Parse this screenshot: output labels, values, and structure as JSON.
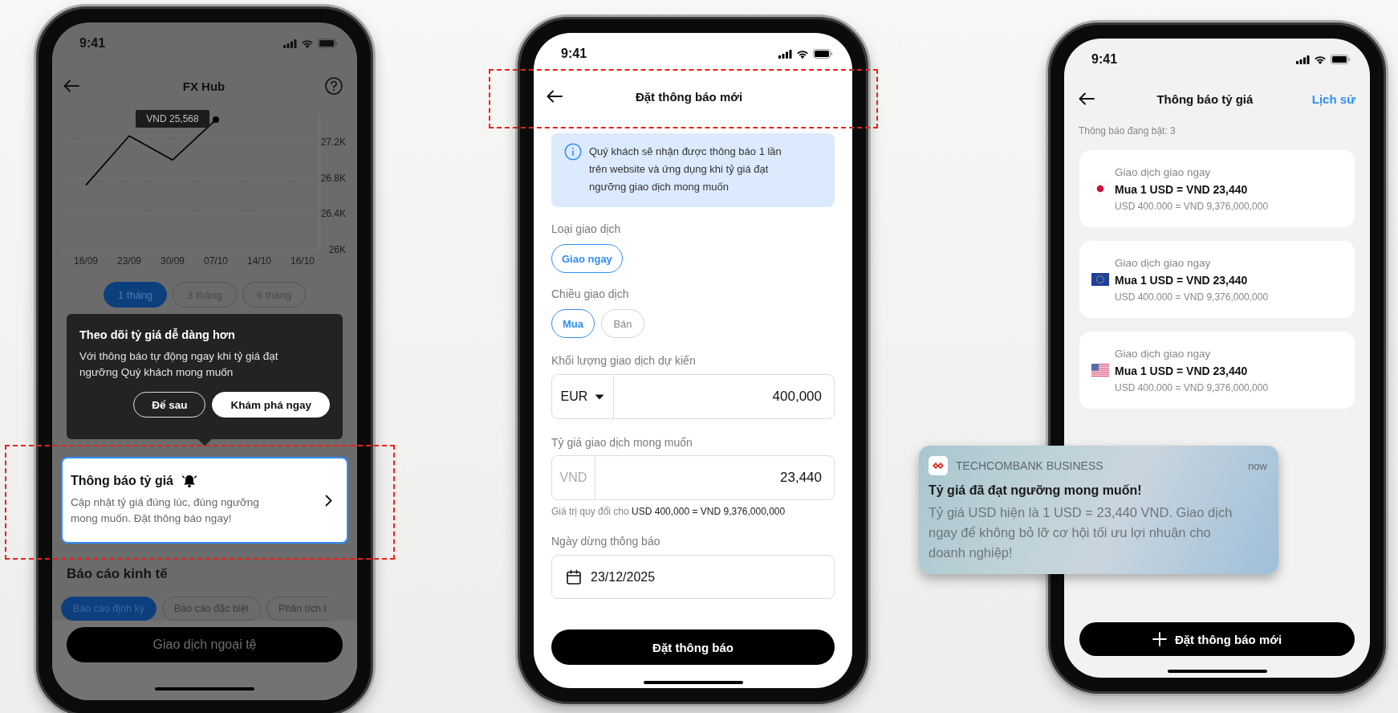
{
  "fx_hub_screen": {
    "status_time": "9:41",
    "title": "FX Hub",
    "chart": {
      "chart_data": {
        "type": "line",
        "categories": [
          "16/09",
          "23/09",
          "30/09",
          "07/10",
          "14/10",
          "16/10"
        ],
        "values": [
          26.72,
          27.27,
          27.0,
          27.45,
          null,
          null
        ],
        "grid": true,
        "ylim": [
          26,
          27.5
        ],
        "yticks": [
          {
            "value": 26,
            "label": "26K"
          },
          {
            "value": 26.4,
            "label": "26.4K"
          },
          {
            "value": 26.8,
            "label": "26.8K"
          },
          {
            "value": 27.2,
            "label": "27.2K"
          }
        ],
        "annotations": [
          {
            "x": "07/10",
            "text": "VND 25,568"
          }
        ]
      }
    },
    "periods": [
      {
        "label": "1 tháng",
        "selected": true
      },
      {
        "label": "3 tháng",
        "selected": false
      },
      {
        "label": "6 tháng",
        "selected": false
      }
    ],
    "coach_mark": {
      "title": "Theo dõi tỷ giá dễ dàng hơn",
      "body": "Với thông báo tự động ngay khi tỷ giá đạt ngưỡng Quý khách mong muốn",
      "buttons": [
        {
          "label": "Để sau",
          "kind": "outline"
        },
        {
          "label": "Khám phá ngay",
          "kind": "filled"
        }
      ]
    },
    "feature_card": {
      "title": "Thông báo tỷ giá",
      "description": "Cập nhật tỷ giá đúng lúc, đúng ngưỡng mong muốn. Đặt thông báo ngay!"
    },
    "section_title": "Báo cáo kinh tế",
    "report_tabs": [
      {
        "label": "Báo cáo định kỳ",
        "selected": true
      },
      {
        "label": "Báo cáo đặc biệt",
        "selected": false
      },
      {
        "label": "Phân tích t",
        "selected": false
      }
    ],
    "primary_button": "Giao dịch ngoại tệ"
  },
  "new_alert_screen": {
    "status_time": "9:41",
    "title": "Đặt thông báo mới",
    "info_text": "Quý khách sẽ nhận được thông báo 1 lần trên website và ứng dụng khi tỷ giá đạt ngưỡng giao dịch mong muốn",
    "transaction_type": {
      "label": "Loại giao dịch",
      "options": [
        {
          "label": "Giao ngay",
          "selected": true
        }
      ]
    },
    "direction": {
      "label": "Chiều giao dịch",
      "options": [
        {
          "label": "Mua",
          "selected": true
        },
        {
          "label": "Bán",
          "selected": false
        }
      ]
    },
    "volume": {
      "label": "Khối lượng giao dịch dự kiến",
      "currency": "EUR",
      "value": "400,000"
    },
    "rate": {
      "label": "Tỷ giá giao dịch mong muốn",
      "prefix": "VND",
      "value": "23,440"
    },
    "conversion_note": "Giá trị quy đổi cho **USD 400,000 = VND 9,376,000,000**",
    "stop_date": {
      "label": "Ngày dừng thông báo",
      "value": "23/12/2025"
    },
    "submit_button": "Đặt thông báo"
  },
  "alerts_list_screen": {
    "status_time": "9:41",
    "title": "Thông báo tỷ giá",
    "history_link": "Lịch sử",
    "active_count": "Thông báo đang bật: 3",
    "alerts": [
      {
        "kind": "jp",
        "type": "Giao dịch giao ngay",
        "rate": "Mua 1 USD = VND 23,440",
        "conversion": "USD 400.000 = VND 9,376,000,000"
      },
      {
        "kind": "eu",
        "type": "Giao dịch giao ngay",
        "rate": "Mua 1 USD = VND 23,440",
        "conversion": "USD 400.000 = VND 9,376,000,000"
      },
      {
        "kind": "us",
        "type": "Giao dịch giao ngay",
        "rate": "Mua 1 USD = VND 23,440",
        "conversion": "USD 400.000 = VND 9,376,000,000"
      }
    ],
    "add_button": "Đặt thông báo mới"
  },
  "notification_banner": {
    "app_name": "TECHCOMBANK BUSINESS",
    "time": "now",
    "title": "Tỷ giá đã đạt ngưỡng mong muốn!",
    "body": "Tỷ giá USD hiện là 1 USD = 23,440 VND. Giao dịch ngay để không bỏ lỡ cơ hội tối ưu lợi nhuận cho doanh nghiệp!"
  }
}
